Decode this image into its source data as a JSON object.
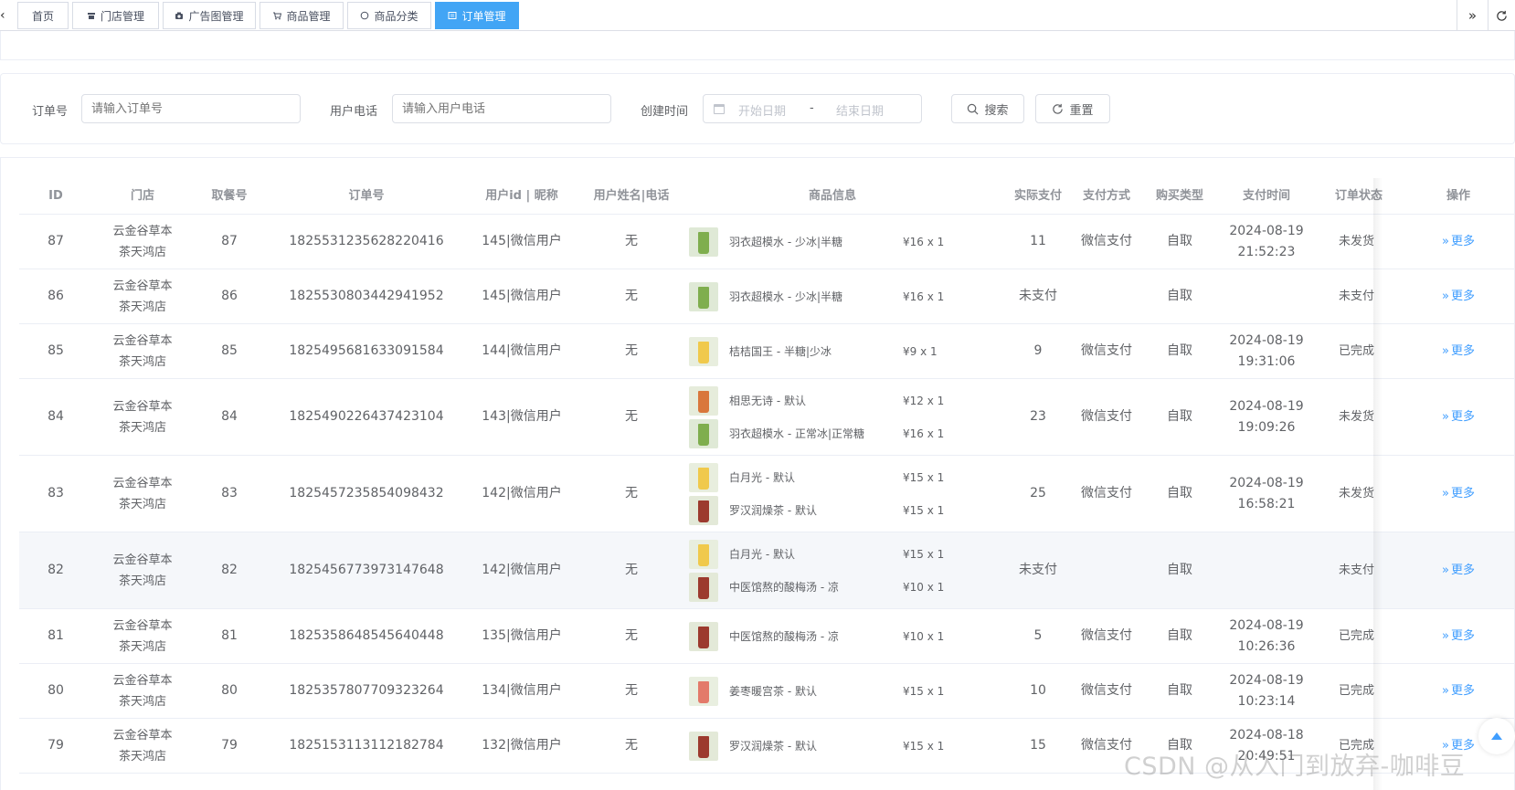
{
  "tabs": [
    {
      "label": "首页",
      "icon": "",
      "active": false
    },
    {
      "label": "门店管理",
      "icon": "store-icon",
      "active": false
    },
    {
      "label": "广告图管理",
      "icon": "camera-icon",
      "active": false
    },
    {
      "label": "商品管理",
      "icon": "cart-icon",
      "active": false
    },
    {
      "label": "商品分类",
      "icon": "chat-icon",
      "active": false
    },
    {
      "label": "订单管理",
      "icon": "list-icon",
      "active": true
    }
  ],
  "tabbar_icons": {
    "left": "chevron-left-icon",
    "scroll_right": "double-chevron-right-icon",
    "refresh": "refresh-icon"
  },
  "search": {
    "order_label": "订单号",
    "order_placeholder": "请输入订单号",
    "phone_label": "用户电话",
    "phone_placeholder": "请输入用户电话",
    "time_label": "创建时间",
    "start_placeholder": "开始日期",
    "range_separator": "-",
    "end_placeholder": "结束日期",
    "search_button": "搜索",
    "reset_button": "重置"
  },
  "table": {
    "headers": {
      "id": "ID",
      "store": "门店",
      "pickup": "取餐号",
      "order_no": "订单号",
      "user": "用户id | 昵称",
      "name_phone": "用户姓名|电话",
      "goods": "商品信息",
      "paid": "实际支付",
      "pay_method": "支付方式",
      "buy_type": "购买类型",
      "pay_time": "支付时间",
      "status": "订单状态",
      "action": "操作"
    },
    "more_label": "更多",
    "rows": [
      {
        "id": "87",
        "store": "云金谷草本茶天鸿店",
        "pickup": "87",
        "order_no": "1825531235628220416",
        "user": "145|微信用户",
        "name_phone": "无",
        "items": [
          {
            "name": "羽衣超模水 - 少冰|半糖",
            "price": "¥16 x 1",
            "thumb": "green"
          }
        ],
        "paid": "11",
        "pay_method": "微信支付",
        "buy_type": "自取",
        "pay_time": "2024-08-19 21:52:23",
        "status": "未发货"
      },
      {
        "id": "86",
        "store": "云金谷草本茶天鸿店",
        "pickup": "86",
        "order_no": "1825530803442941952",
        "user": "145|微信用户",
        "name_phone": "无",
        "items": [
          {
            "name": "羽衣超模水 - 少冰|半糖",
            "price": "¥16 x 1",
            "thumb": "green"
          }
        ],
        "paid": "未支付",
        "pay_method": "",
        "buy_type": "自取",
        "pay_time": "",
        "status": "未支付"
      },
      {
        "id": "85",
        "store": "云金谷草本茶天鸿店",
        "pickup": "85",
        "order_no": "1825495681633091584",
        "user": "144|微信用户",
        "name_phone": "无",
        "items": [
          {
            "name": "桔桔国王 - 半糖|少冰",
            "price": "¥9 x 1",
            "thumb": "yellow"
          }
        ],
        "paid": "9",
        "pay_method": "微信支付",
        "buy_type": "自取",
        "pay_time": "2024-08-19 19:31:06",
        "status": "已完成"
      },
      {
        "id": "84",
        "store": "云金谷草本茶天鸿店",
        "pickup": "84",
        "order_no": "1825490226437423104",
        "user": "143|微信用户",
        "name_phone": "无",
        "items": [
          {
            "name": "相思无诗 - 默认",
            "price": "¥12 x 1",
            "thumb": "orange"
          },
          {
            "name": "羽衣超模水 - 正常冰|正常糖",
            "price": "¥16 x 1",
            "thumb": "green"
          }
        ],
        "paid": "23",
        "pay_method": "微信支付",
        "buy_type": "自取",
        "pay_time": "2024-08-19 19:09:26",
        "status": "未发货"
      },
      {
        "id": "83",
        "store": "云金谷草本茶天鸿店",
        "pickup": "83",
        "order_no": "1825457235854098432",
        "user": "142|微信用户",
        "name_phone": "无",
        "items": [
          {
            "name": "白月光 - 默认",
            "price": "¥15 x 1",
            "thumb": "yellow"
          },
          {
            "name": "罗汉润燥茶 - 默认",
            "price": "¥15 x 1",
            "thumb": "red"
          }
        ],
        "paid": "25",
        "pay_method": "微信支付",
        "buy_type": "自取",
        "pay_time": "2024-08-19 16:58:21",
        "status": "未发货"
      },
      {
        "id": "82",
        "store": "云金谷草本茶天鸿店",
        "pickup": "82",
        "order_no": "1825456773973147648",
        "user": "142|微信用户",
        "name_phone": "无",
        "items": [
          {
            "name": "白月光 - 默认",
            "price": "¥15 x 1",
            "thumb": "yellow"
          },
          {
            "name": "中医馆熬的酸梅汤 - 凉",
            "price": "¥10 x 1",
            "thumb": "red"
          }
        ],
        "paid": "未支付",
        "pay_method": "",
        "buy_type": "自取",
        "pay_time": "",
        "status": "未支付",
        "highlight": true
      },
      {
        "id": "81",
        "store": "云金谷草本茶天鸿店",
        "pickup": "81",
        "order_no": "1825358648545640448",
        "user": "135|微信用户",
        "name_phone": "无",
        "items": [
          {
            "name": "中医馆熬的酸梅汤 - 凉",
            "price": "¥10 x 1",
            "thumb": "red"
          }
        ],
        "paid": "5",
        "pay_method": "微信支付",
        "buy_type": "自取",
        "pay_time": "2024-08-19 10:26:36",
        "status": "已完成"
      },
      {
        "id": "80",
        "store": "云金谷草本茶天鸿店",
        "pickup": "80",
        "order_no": "1825357807709323264",
        "user": "134|微信用户",
        "name_phone": "无",
        "items": [
          {
            "name": "姜枣暖宫茶 - 默认",
            "price": "¥15 x 1",
            "thumb": "pink"
          }
        ],
        "paid": "10",
        "pay_method": "微信支付",
        "buy_type": "自取",
        "pay_time": "2024-08-19 10:23:14",
        "status": "已完成"
      },
      {
        "id": "79",
        "store": "云金谷草本茶天鸿店",
        "pickup": "79",
        "order_no": "1825153113112182784",
        "user": "132|微信用户",
        "name_phone": "无",
        "items": [
          {
            "name": "罗汉润燥茶 - 默认",
            "price": "¥15 x 1",
            "thumb": "red"
          }
        ],
        "paid": "15",
        "pay_method": "微信支付",
        "buy_type": "自取",
        "pay_time": "2024-08-18 20:49:51",
        "status": "已完成"
      }
    ]
  },
  "watermark": "CSDN @从入门到放弃-咖啡豆",
  "colors": {
    "primary": "#409eff",
    "tab_active": "#42a5f5",
    "text": "#606266",
    "header_text": "#909399",
    "border": "#ebeef5"
  }
}
